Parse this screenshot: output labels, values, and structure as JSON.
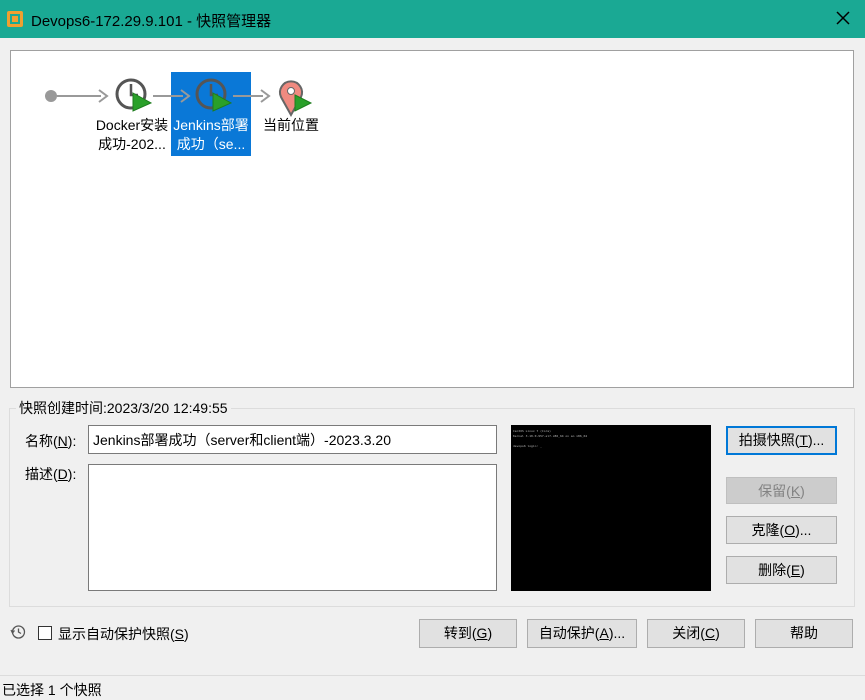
{
  "window": {
    "title": "Devops6-172.29.9.101 - 快照管理器"
  },
  "tree": {
    "nodes": [
      {
        "label_line1": "Docker安装",
        "label_line2": "成功-202...",
        "selected": false
      },
      {
        "label_line1": "Jenkins部署",
        "label_line2": "成功（se...",
        "selected": true
      },
      {
        "label_line1": "当前位置",
        "label_line2": "",
        "selected": false
      }
    ]
  },
  "details": {
    "created_label": "快照创建时间:2023/3/20 12:49:55",
    "name_label": {
      "pre": "名称(",
      "key": "N",
      "post": "):"
    },
    "name_value": "Jenkins部署成功（server和client端）-2023.3.20",
    "desc_label": {
      "pre": "描述(",
      "key": "D",
      "post": "):"
    },
    "desc_value": "",
    "thumbnail": {
      "line1": "CentOS Linux 7 (Core)",
      "line2": "Kernel 3.10.0-957.el7.x86_64 on an x86_64",
      "line3": "devops6 login: _"
    }
  },
  "side_buttons": {
    "take": {
      "pre": "拍摄快照(",
      "key": "T",
      "post": ")..."
    },
    "keep": {
      "pre": "保留(",
      "key": "K",
      "post": ")"
    },
    "clone": {
      "pre": "克隆(",
      "key": "O",
      "post": ")..."
    },
    "delete": {
      "pre": "删除(",
      "key": "E",
      "post": ")"
    }
  },
  "footer": {
    "show_auto": {
      "pre": "显示自动保护快照(",
      "key": "S",
      "post": ")",
      "checked": false
    },
    "goto": {
      "pre": "转到(",
      "key": "G",
      "post": ")"
    },
    "autoprotect": {
      "pre": "自动保护(",
      "key": "A",
      "post": ")..."
    },
    "close": {
      "pre": "关闭(",
      "key": "C",
      "post": ")"
    },
    "help": "帮助"
  },
  "status": {
    "text": "已选择 1 个快照"
  },
  "colors": {
    "titlebar": "#1aa994",
    "selection": "#0a78d7",
    "focus_border": "#0078d7"
  }
}
